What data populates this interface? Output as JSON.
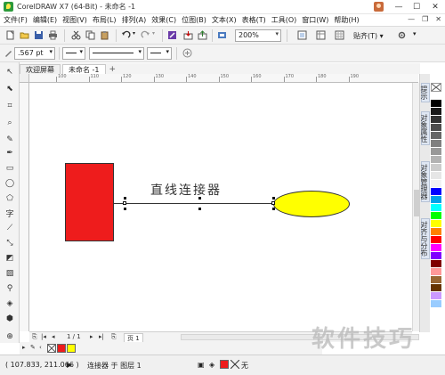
{
  "window": {
    "title": "CorelDRAW X7 (64-Bit) - 未命名 -1",
    "minimize": "—",
    "maximize": "☐",
    "close": "✕"
  },
  "menu": {
    "items": [
      "文件(F)",
      "编辑(E)",
      "视图(V)",
      "布局(L)",
      "排列(A)",
      "效果(C)",
      "位图(B)",
      "文本(X)",
      "表格(T)",
      "工具(O)",
      "窗口(W)",
      "帮助(H)"
    ],
    "controls": [
      "—",
      "❐",
      "✕"
    ]
  },
  "toolbar": {
    "zoom_value": "200%",
    "snap_label": "贴齐(T) ▾"
  },
  "propbar": {
    "outline_width": ".567 pt"
  },
  "tabs": [
    {
      "label": "欢迎屏幕",
      "active": false
    },
    {
      "label": "未命名 -1",
      "active": true
    }
  ],
  "ruler": {
    "top_ticks": [
      "100",
      "110",
      "120",
      "130",
      "140",
      "150",
      "160",
      "170",
      "180",
      "190"
    ]
  },
  "canvas": {
    "text": "直线连接器",
    "rect_color": "#ee1c1c",
    "ellipse_color": "#ffff00"
  },
  "dockers": {
    "tabs": [
      "提示",
      "对象属性",
      "对象管理器",
      "对齐与分布"
    ]
  },
  "palette": {
    "colors": [
      "#ffffff",
      "#000000",
      "#1a1a1a",
      "#333333",
      "#4d4d4d",
      "#666666",
      "#808080",
      "#999999",
      "#b3b3b3",
      "#cccccc",
      "#e6e6e6",
      "#f2f2f2",
      "#0000ff",
      "#00a0e9",
      "#00ffff",
      "#00ff00",
      "#ffff00",
      "#ff8000",
      "#ff0000",
      "#ff00ff",
      "#8000ff",
      "#800000",
      "#ff9999",
      "#996633",
      "#663300",
      "#cc99ff",
      "#99ccff"
    ]
  },
  "pagenav": {
    "page_count": "1 / 1",
    "page_tab": "页 1"
  },
  "fill": {
    "fill_color": "#ee1c1c",
    "outline_color": "#ffff00"
  },
  "status": {
    "coords": "( 107.833, 211.066 )",
    "object_info": "连接器 于 图层 1",
    "fill_none": "无"
  },
  "watermark": {
    "text": "软件技巧"
  }
}
